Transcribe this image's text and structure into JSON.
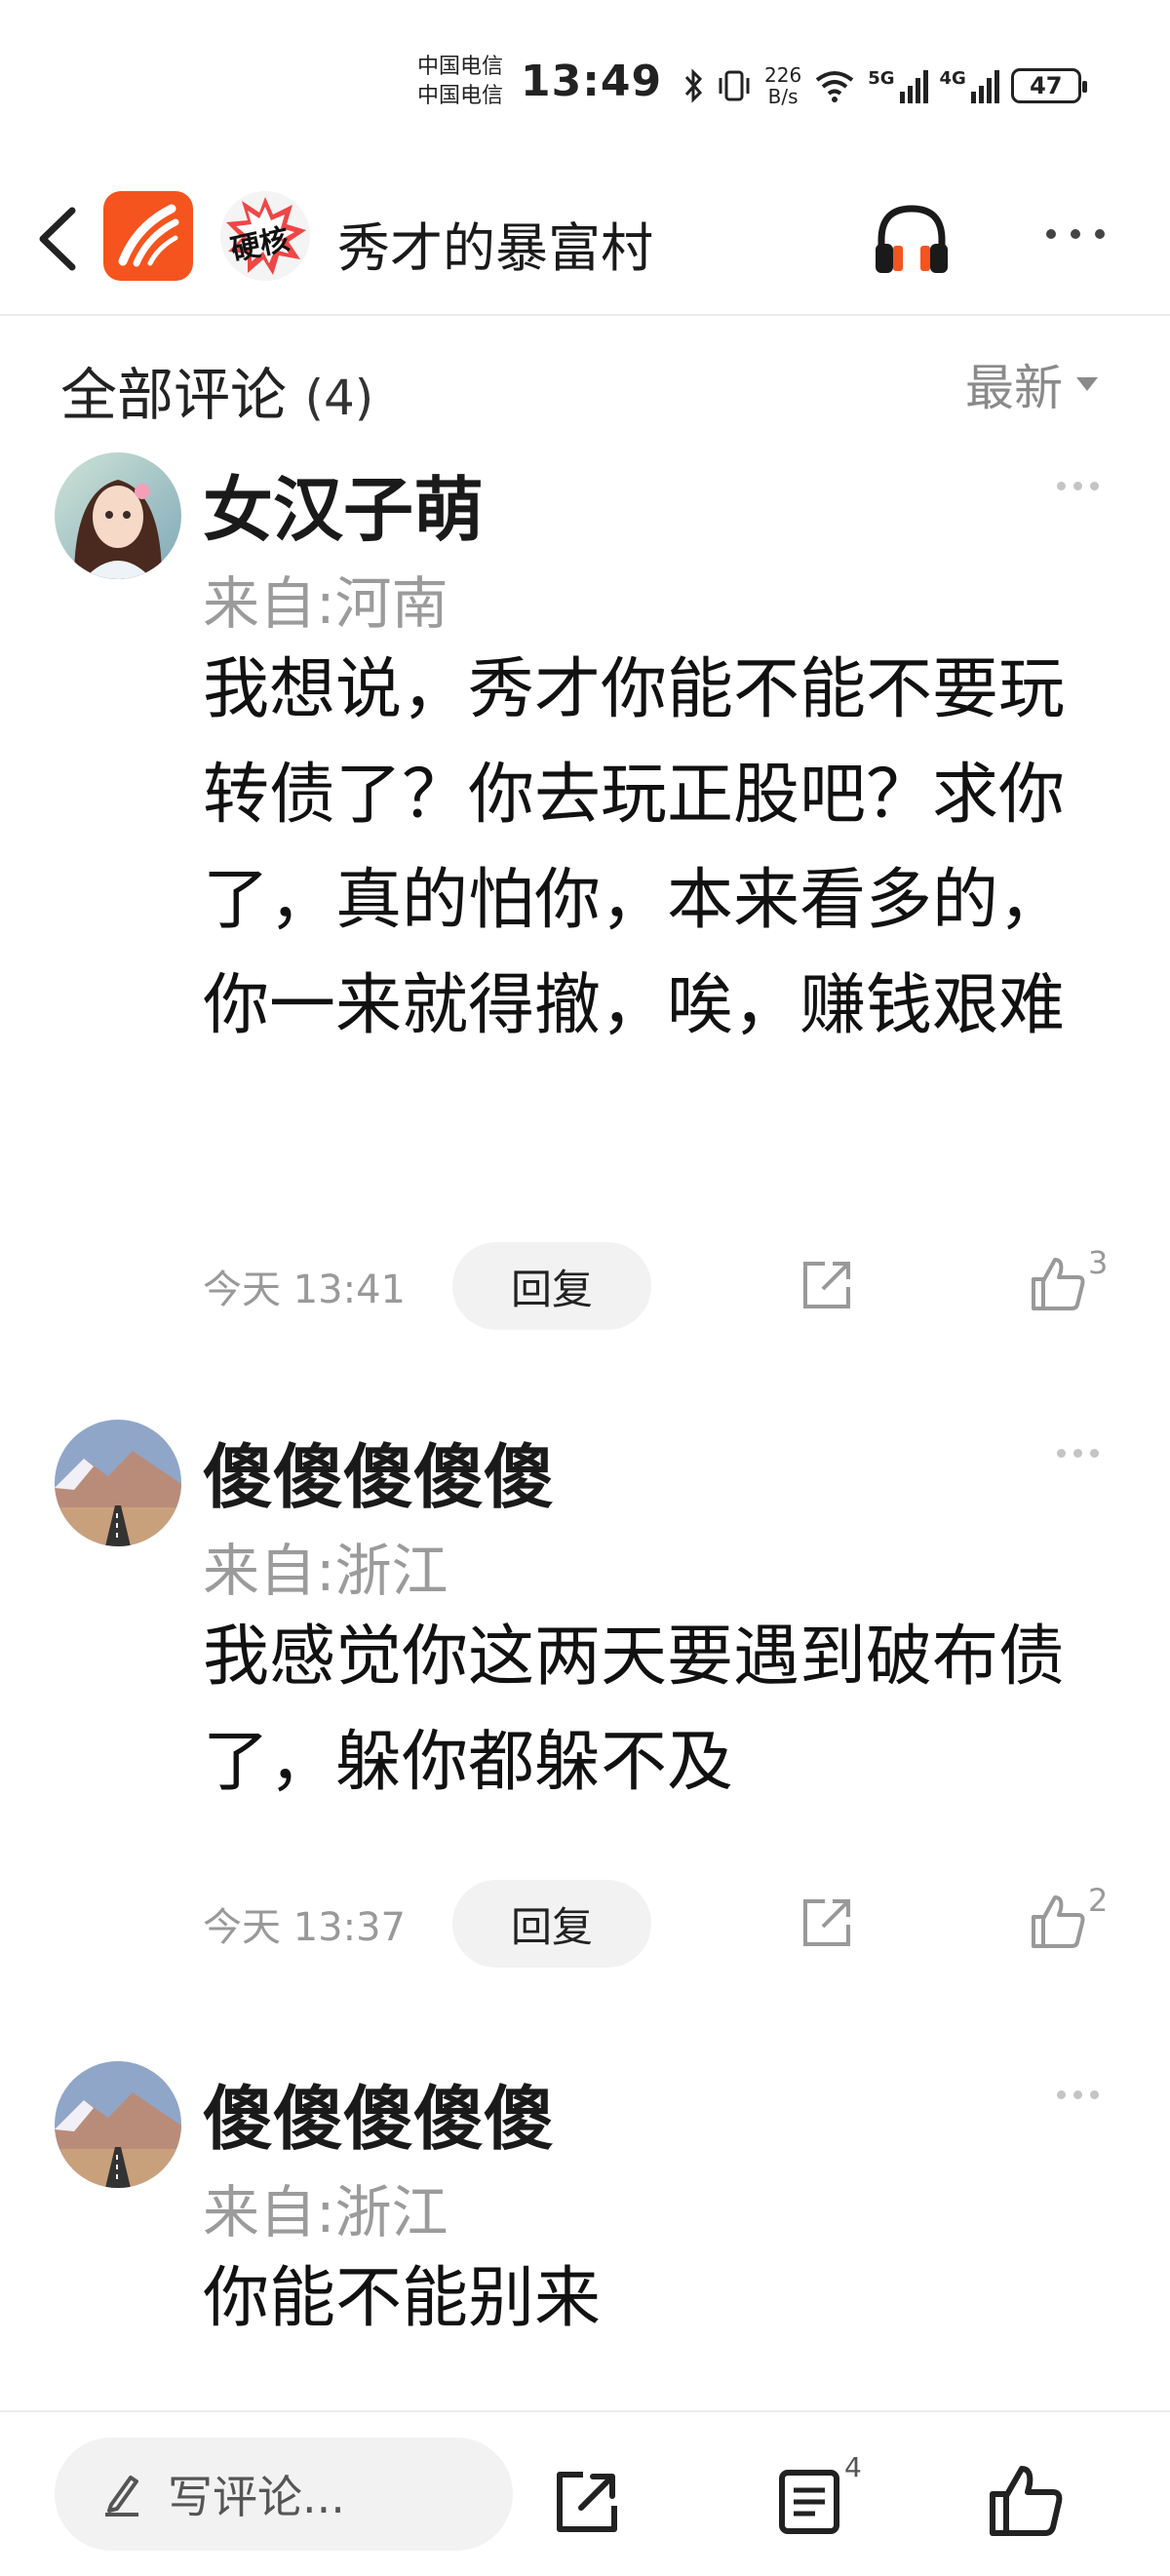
{
  "status_bar": {
    "carrier1": "中国电信",
    "carrier2": "中国电信",
    "time": "13:49",
    "net_speed_value": "226",
    "net_speed_unit": "B/s",
    "signal1_label": "5G",
    "signal2_label": "4G",
    "battery": "47"
  },
  "header": {
    "title": "秀才的暴富村",
    "badge_text": "硬核"
  },
  "section": {
    "title": "全部评论",
    "count": "(4)",
    "sort_label": "最新"
  },
  "comments": [
    {
      "name": "女汉子萌",
      "location": "来自:河南",
      "text": "我想说，秀才你能不能不要玩转债了？你去玩正股吧？求你了，真的怕你，本来看多的，你一来就得撤，唉，赚钱艰难",
      "time": "今天 13:41",
      "reply_label": "回复",
      "likes": "3"
    },
    {
      "name": "傻傻傻傻傻",
      "location": "来自:浙江",
      "text": "我感觉你这两天要遇到破布债了，躲你都躲不及",
      "time": "今天 13:37",
      "reply_label": "回复",
      "likes": "2"
    },
    {
      "name": "傻傻傻傻傻",
      "location": "来自:浙江",
      "text": "你能不能别来"
    }
  ],
  "bottom_bar": {
    "write_placeholder": "写评论...",
    "comment_count": "4"
  },
  "colors": {
    "app_orange": "#f5541e",
    "muted_gray": "#9b9b9b",
    "reply_bg": "#f2f2f2"
  }
}
